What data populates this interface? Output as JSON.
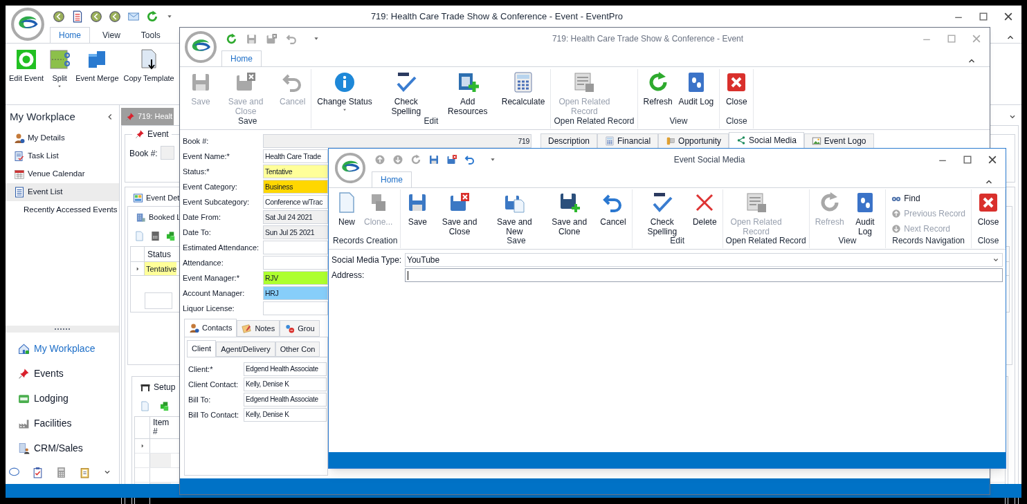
{
  "main_window": {
    "title": "719: Health Care Trade Show & Conference - Event - EventPro",
    "tabs": [
      {
        "label": "Home",
        "selected": true
      },
      {
        "label": "View",
        "selected": false
      },
      {
        "label": "Tools",
        "selected": false
      }
    ],
    "ribbon": [
      {
        "label": "Edit Event",
        "dropdown": false
      },
      {
        "label": "Split",
        "dropdown": true
      },
      {
        "label": "Event Merge",
        "dropdown": false
      },
      {
        "label": "Copy Template",
        "dropdown": false
      }
    ],
    "sidebar": {
      "title": "My Workplace",
      "items": [
        {
          "label": "My Details",
          "selected": false
        },
        {
          "label": "Task List",
          "selected": false
        },
        {
          "label": "Venue Calendar",
          "selected": false
        },
        {
          "label": "Event List",
          "selected": true
        },
        {
          "label": "Recently Accessed Events",
          "selected": false
        }
      ],
      "nav": [
        {
          "label": "My Workplace",
          "selected": true
        },
        {
          "label": "Events",
          "selected": false
        },
        {
          "label": "Lodging",
          "selected": false
        },
        {
          "label": "Facilities",
          "selected": false
        },
        {
          "label": "CRM/Sales",
          "selected": false
        }
      ]
    },
    "document_tab": "719: Healt",
    "event_group": "Event",
    "book_label": "Book #:",
    "details_tab": "Event Det",
    "booked_tab": "Booked L",
    "booked_grid": {
      "column": "Status",
      "rows": [
        "Tentative"
      ]
    },
    "setup_tab": "Setup",
    "setup_grid": {
      "column": "Item #"
    }
  },
  "event_window": {
    "title": "719: Health Care Trade Show & Conference - Event",
    "tabs": [
      {
        "label": "Home",
        "selected": true
      }
    ],
    "groups": [
      {
        "label": "Save",
        "buttons": [
          {
            "label": "Save",
            "disabled": true,
            "dropdown": false
          },
          {
            "label": "Save and Close",
            "disabled": true,
            "dropdown": false
          },
          {
            "label": "Cancel",
            "disabled": true,
            "dropdown": false
          }
        ]
      },
      {
        "label": "Edit",
        "buttons": [
          {
            "label": "Change Status",
            "disabled": false,
            "dropdown": true
          },
          {
            "label": "Check Spelling",
            "disabled": false,
            "dropdown": false
          },
          {
            "label": "Add Resources",
            "disabled": false,
            "dropdown": false
          },
          {
            "label": "Recalculate",
            "disabled": false,
            "dropdown": false
          }
        ]
      },
      {
        "label": "Open Related Record",
        "buttons": [
          {
            "label": "Open Related Record",
            "disabled": true,
            "dropdown": false
          }
        ]
      },
      {
        "label": "View",
        "buttons": [
          {
            "label": "Refresh",
            "disabled": false,
            "dropdown": false
          },
          {
            "label": "Audit Log",
            "disabled": false,
            "dropdown": false
          }
        ]
      },
      {
        "label": "Close",
        "buttons": [
          {
            "label": "Close",
            "disabled": false,
            "dropdown": false
          }
        ]
      }
    ],
    "fields": [
      {
        "label": "Book #:",
        "value": "719",
        "disabled": true
      },
      {
        "label": "Event Name:*",
        "value": "Health Care Trade",
        "disabled": false
      },
      {
        "label": "Status:*",
        "value": "Tentative",
        "color": "#ffff99"
      },
      {
        "label": "Event Category:",
        "value": "Business",
        "color": "#ffd700"
      },
      {
        "label": "Event Subcategory:",
        "value": "Conference w/Trac",
        "disabled": false
      },
      {
        "label": "Date From:",
        "value": "Sat Jul 24 2021",
        "disabled": true
      },
      {
        "label": "Date To:",
        "value": "Sun Jul 25 2021",
        "disabled": true
      },
      {
        "label": "Estimated Attendance:",
        "disabled": false
      },
      {
        "label": "Attendance:",
        "disabled": false
      },
      {
        "label": "Event Manager:*",
        "value": "RJV",
        "color": "#adff2f"
      },
      {
        "label": "Account Manager:",
        "value": "HRJ",
        "color": "#87cefa"
      },
      {
        "label": "Liquor License:",
        "disabled": false
      }
    ],
    "detail_tabs": [
      {
        "label": "Description",
        "selected": false
      },
      {
        "label": "Financial",
        "selected": false
      },
      {
        "label": "Opportunity",
        "selected": false
      },
      {
        "label": "Social Media",
        "selected": true
      },
      {
        "label": "Event Logo",
        "selected": false
      }
    ],
    "contact_tabs": [
      {
        "label": "Contacts",
        "selected": true
      },
      {
        "label": "Notes",
        "selected": false
      },
      {
        "label": "Grou",
        "selected": false
      }
    ],
    "client_tabs": [
      {
        "label": "Client",
        "selected": true
      },
      {
        "label": "Agent/Delivery",
        "selected": false
      },
      {
        "label": "Other Con",
        "selected": false
      }
    ],
    "client_fields": [
      {
        "label": "Client:*",
        "value": "Edgend Health Associate"
      },
      {
        "label": "Client Contact:",
        "value": "Kelly, Denise K"
      },
      {
        "label": "Bill To:",
        "value": "Edgend Health Associate"
      },
      {
        "label": "Bill To Contact:",
        "value": "Kelly, Denise K"
      }
    ]
  },
  "social_window": {
    "title": "Event Social Media",
    "tabs": [
      {
        "label": "Home",
        "selected": true
      }
    ],
    "groups": [
      {
        "label": "Records Creation",
        "buttons": [
          {
            "label": "New",
            "disabled": false,
            "kind": "large"
          },
          {
            "label": "Clone...",
            "disabled": true,
            "kind": "large"
          }
        ]
      },
      {
        "label": "Save",
        "buttons": [
          {
            "label": "Save",
            "disabled": false,
            "kind": "large"
          },
          {
            "label": "Save and Close",
            "disabled": false,
            "kind": "large"
          },
          {
            "label": "Save and New",
            "disabled": false,
            "kind": "large"
          },
          {
            "label": "Save and Clone",
            "disabled": false,
            "kind": "large"
          },
          {
            "label": "Cancel",
            "disabled": false,
            "kind": "large"
          }
        ]
      },
      {
        "label": "Edit",
        "buttons": [
          {
            "label": "Check Spelling",
            "disabled": false,
            "kind": "large"
          },
          {
            "label": "Delete",
            "disabled": false,
            "kind": "large"
          }
        ]
      },
      {
        "label": "Open Related Record",
        "buttons": [
          {
            "label": "Open Related Record",
            "disabled": true,
            "kind": "large"
          }
        ]
      },
      {
        "label": "View",
        "buttons": [
          {
            "label": "Refresh",
            "disabled": true,
            "kind": "large"
          },
          {
            "label": "Audit Log",
            "disabled": false,
            "kind": "large"
          }
        ]
      },
      {
        "label": "Records Navigation",
        "buttons": [
          {
            "label": "Find",
            "disabled": false,
            "kind": "small"
          },
          {
            "label": "Previous Record",
            "disabled": true,
            "kind": "small"
          },
          {
            "label": "Next Record",
            "disabled": true,
            "kind": "small"
          }
        ]
      },
      {
        "label": "Close",
        "buttons": [
          {
            "label": "Close",
            "disabled": false,
            "kind": "large"
          }
        ]
      }
    ],
    "fields": [
      {
        "label": "Social Media Type:",
        "kind": "dropdown",
        "value": "YouTube",
        "focused": false
      },
      {
        "label": "Address:",
        "kind": "text",
        "focused": true
      }
    ]
  }
}
